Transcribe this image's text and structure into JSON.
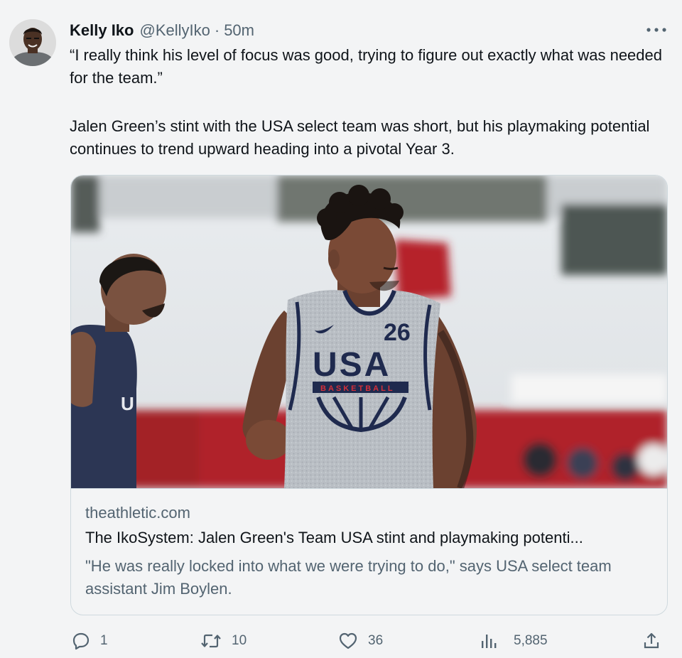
{
  "tweet": {
    "author": {
      "display_name": "Kelly Iko",
      "handle": "@KellyIko",
      "separator": "·",
      "time": "50m"
    },
    "quote_text": "“I really think his level of focus was good, trying to figure out exactly what was needed for the team.”",
    "body_text": "Jalen Green’s stint with the USA select team was short, but his playmaking potential continues to trend upward heading into a pivotal Year 3.",
    "more_icon": "more-horizontal-icon"
  },
  "card": {
    "image": {
      "jersey_number": "26",
      "jersey_wordmark": "USA",
      "jersey_banner": "BASKETBALL"
    },
    "domain": "theathletic.com",
    "title": "The IkoSystem: Jalen Green's Team USA stint and playmaking potenti...",
    "description": "\"He was really locked into what we were trying to do,\" says USA select team assistant Jim Boylen."
  },
  "actions": {
    "reply": {
      "icon": "reply-icon",
      "count": "1"
    },
    "retweet": {
      "icon": "retweet-icon",
      "count": "10"
    },
    "like": {
      "icon": "heart-icon",
      "count": "36"
    },
    "views": {
      "icon": "views-chart-icon",
      "count": "5,885"
    },
    "share": {
      "icon": "share-icon"
    }
  },
  "colors": {
    "background": "#f3f4f5",
    "primary_text": "#0f1419",
    "secondary_text": "#536471",
    "border": "#cfd9de"
  }
}
